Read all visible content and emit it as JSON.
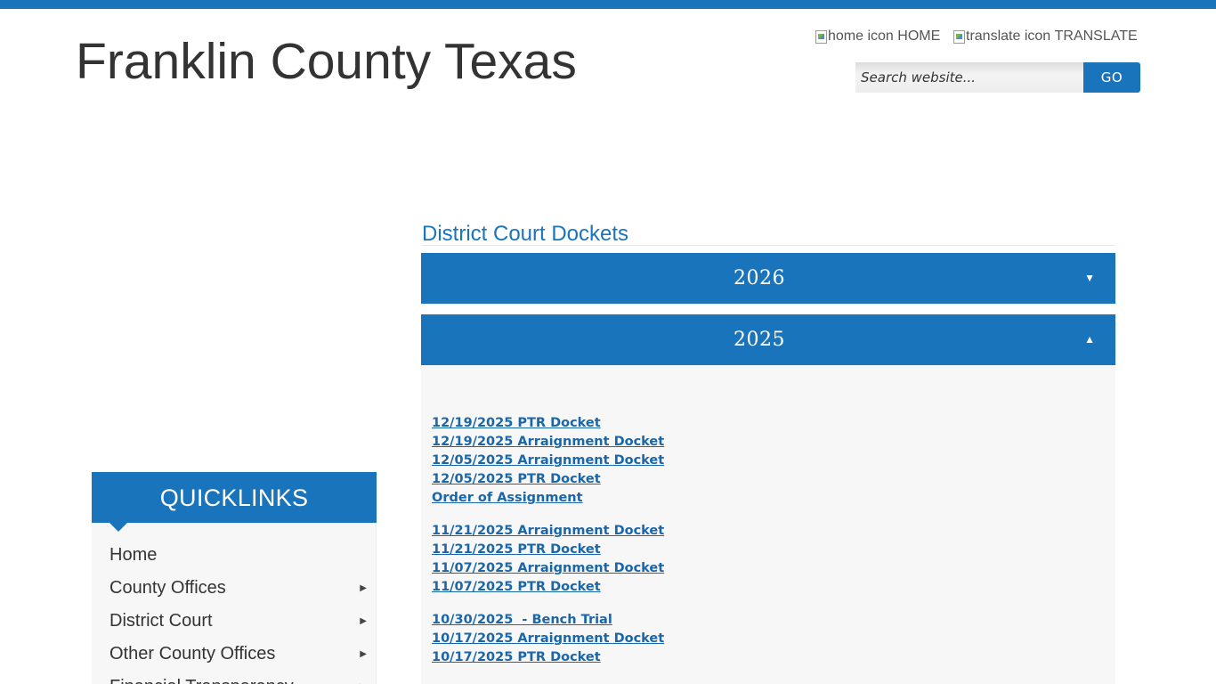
{
  "header": {
    "site_title": "Franklin County Texas",
    "home_link": "HOME",
    "home_icon_alt": "home icon",
    "translate_link": "TRANSLATE",
    "translate_icon_alt": "translate icon",
    "search_placeholder": "Search website...",
    "search_button": "GO"
  },
  "main": {
    "section_title": "District Court Dockets",
    "accordion": [
      {
        "year": "2026",
        "expanded": false,
        "toggle_glyph": "▼"
      },
      {
        "year": "2025",
        "expanded": true,
        "toggle_glyph": "▲"
      }
    ],
    "docket_groups": [
      [
        "12/19/2025 PTR Docket",
        "12/19/2025 Arraignment Docket",
        "12/05/2025 Arraignment Docket",
        "12/05/2025 PTR Docket",
        "Order of Assignment"
      ],
      [
        "11/21/2025 Arraignment Docket",
        "11/21/2025 PTR Docket",
        "11/07/2025 Arraignment Docket",
        "11/07/2025 PTR Docket"
      ],
      [
        "10/30/2025  - Bench Trial",
        "10/17/2025 Arraignment Docket",
        "10/17/2025 PTR Docket"
      ]
    ]
  },
  "quicklinks": {
    "title": "QUICKLINKS",
    "items": [
      {
        "label": "Home",
        "has_submenu": false
      },
      {
        "label": "County Offices",
        "has_submenu": true
      },
      {
        "label": "District Court",
        "has_submenu": true
      },
      {
        "label": "Other County Offices",
        "has_submenu": true
      },
      {
        "label": "Financial Transparency",
        "has_submenu": true
      }
    ],
    "submenu_glyph": "▶"
  },
  "colors": {
    "accent": "#1a74bb",
    "panel_bg": "#f7f7f7",
    "link": "#1a66a8"
  }
}
